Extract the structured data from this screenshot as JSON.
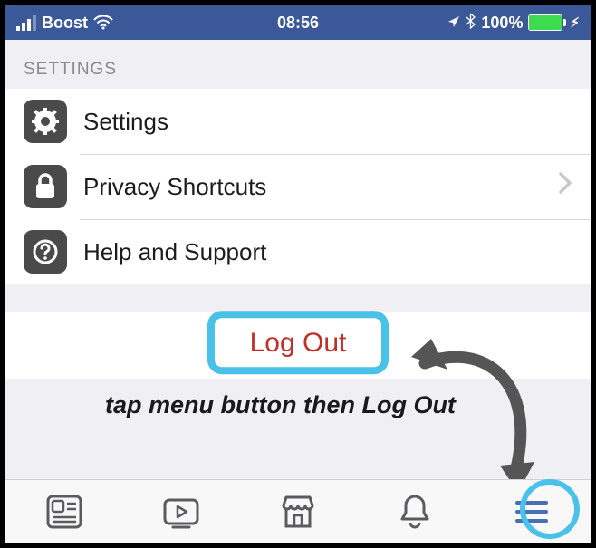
{
  "status": {
    "carrier": "Boost",
    "time": "08:56",
    "battery_pct": "100%"
  },
  "section_header": "SETTINGS",
  "rows": {
    "settings": "Settings",
    "privacy": "Privacy Shortcuts",
    "help": "Help and Support"
  },
  "logout_label": "Log Out",
  "annotation_text": "tap menu button then Log Out"
}
